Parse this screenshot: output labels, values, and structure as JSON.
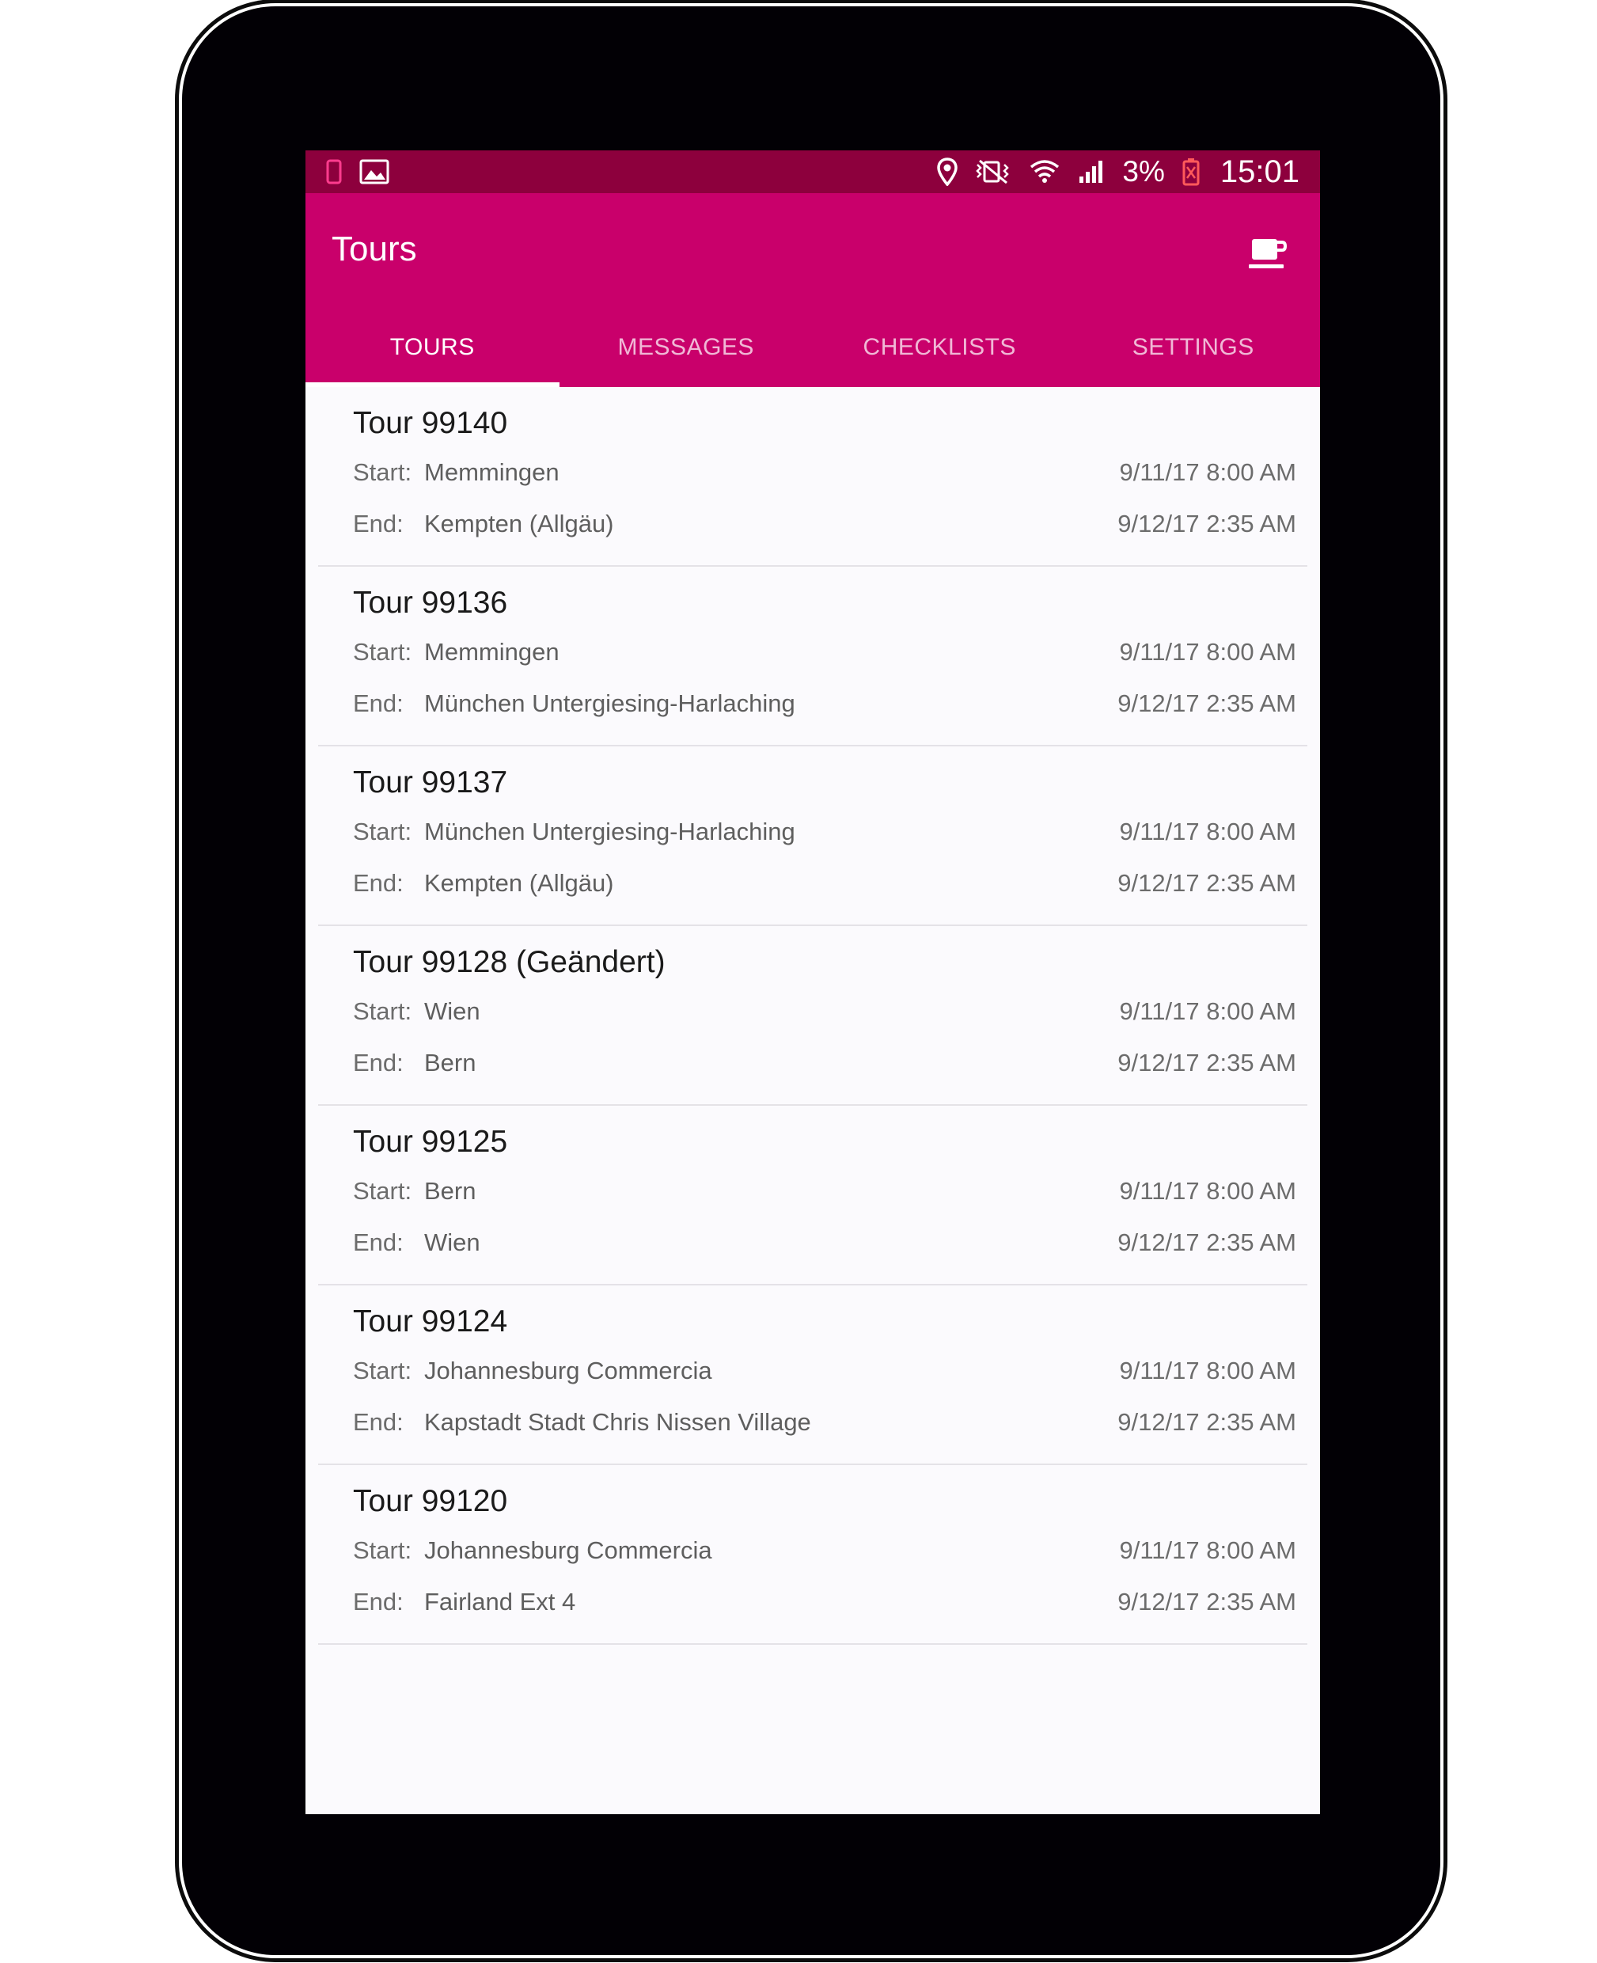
{
  "status_bar": {
    "battery_text": "3%",
    "time": "15:01",
    "icons_left": [
      "phone-icon",
      "image-icon"
    ],
    "icons_right": [
      "location-icon",
      "vibrate-mute-icon",
      "wifi-icon",
      "signal-icon",
      "battery-icon"
    ]
  },
  "app_bar": {
    "title": "Tours",
    "action_icon": "coffee-break-icon"
  },
  "tabs": [
    {
      "label": "TOURS",
      "active": true
    },
    {
      "label": "MESSAGES",
      "active": false
    },
    {
      "label": "CHECKLISTS",
      "active": false
    },
    {
      "label": "SETTINGS",
      "active": false
    }
  ],
  "labels": {
    "start": "Start:",
    "end": "End:"
  },
  "tours": [
    {
      "title": "Tour 99140",
      "start": "Memmingen",
      "start_time": "9/11/17 8:00 AM",
      "end": "Kempten (Allgäu)",
      "end_time": "9/12/17 2:35 AM"
    },
    {
      "title": "Tour 99136",
      "start": "Memmingen",
      "start_time": "9/11/17 8:00 AM",
      "end": "München Untergiesing-Harlaching",
      "end_time": "9/12/17 2:35 AM"
    },
    {
      "title": "Tour 99137",
      "start": "München Untergiesing-Harlaching",
      "start_time": "9/11/17 8:00 AM",
      "end": "Kempten (Allgäu)",
      "end_time": "9/12/17 2:35 AM"
    },
    {
      "title": "Tour 99128 (Geändert)",
      "start": "Wien",
      "start_time": "9/11/17 8:00 AM",
      "end": "Bern",
      "end_time": "9/12/17 2:35 AM"
    },
    {
      "title": "Tour 99125",
      "start": "Bern",
      "start_time": "9/11/17 8:00 AM",
      "end": "Wien",
      "end_time": "9/12/17 2:35 AM"
    },
    {
      "title": "Tour 99124",
      "start": "Johannesburg Commercia",
      "start_time": "9/11/17 8:00 AM",
      "end": "Kapstadt Stadt Chris Nissen Village",
      "end_time": "9/12/17 2:35 AM"
    },
    {
      "title": "Tour 99120",
      "start": "Johannesburg Commercia",
      "start_time": "9/11/17 8:00 AM",
      "end": "Fairland Ext 4",
      "end_time": "9/12/17 2:35 AM"
    }
  ],
  "colors": {
    "status_bar": "#8d003d",
    "app_bar": "#c9006b",
    "list_background": "#fbfafd",
    "device_frame": "#020005"
  }
}
